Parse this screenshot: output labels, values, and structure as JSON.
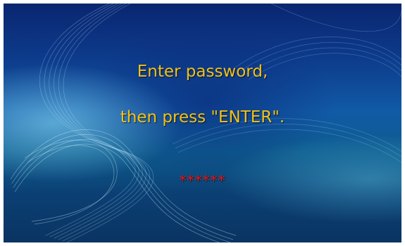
{
  "prompt": {
    "line1": "Enter password,",
    "line2": "then press \"ENTER\"."
  },
  "password": {
    "masked_value": "******"
  },
  "colors": {
    "prompt_text": "#f2c21a",
    "password_mask": "#e81414",
    "background_dark": "#0a2670",
    "background_mid": "#115aa6"
  }
}
